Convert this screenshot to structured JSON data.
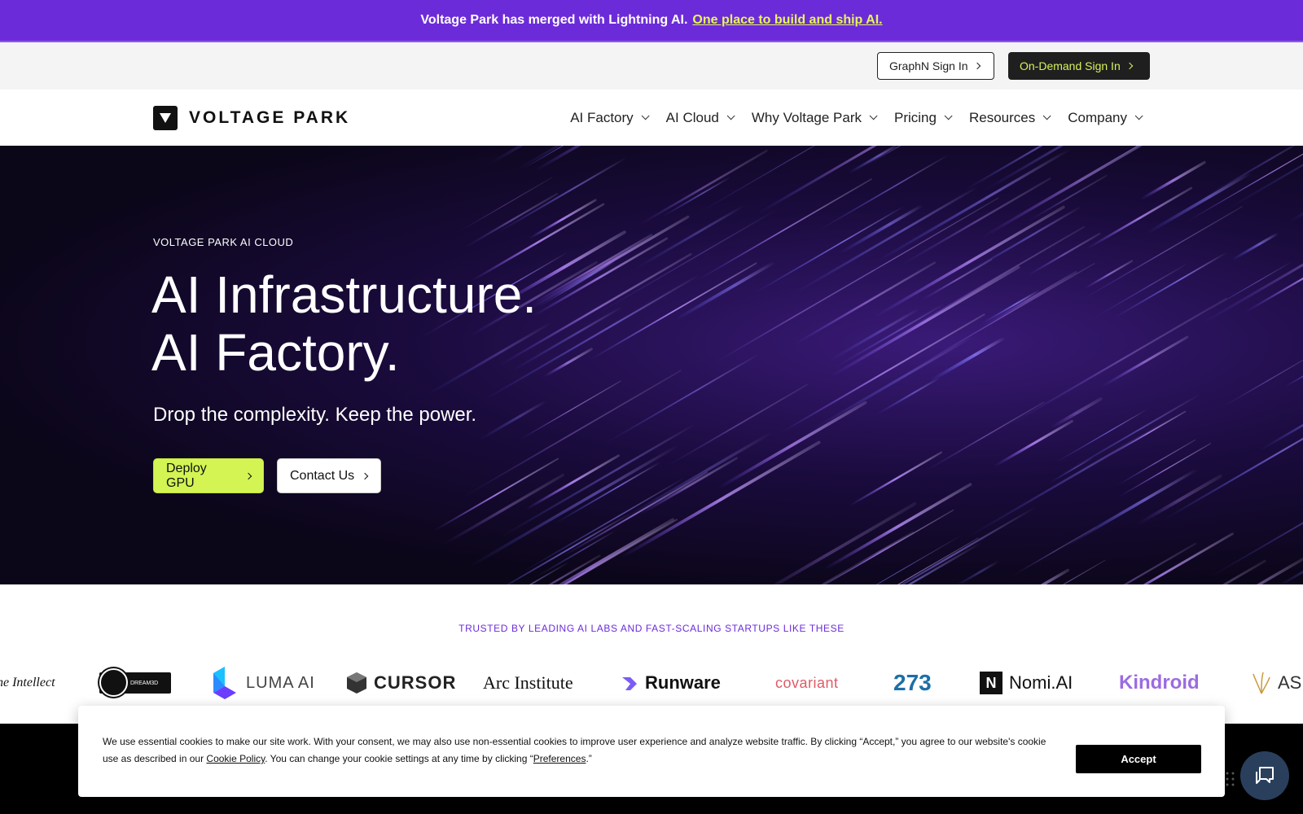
{
  "announcement": {
    "text": "Voltage Park has merged with Lightning AI.",
    "link": "One place to build and ship AI."
  },
  "account_bar": {
    "graphn_label": "GraphN Sign In",
    "ondemand_label": "On-Demand Sign In"
  },
  "nav": {
    "logo_text": "VOLTAGE PARK",
    "items": [
      "AI Factory",
      "AI Cloud",
      "Why Voltage Park",
      "Pricing",
      "Resources",
      "Company"
    ]
  },
  "hero": {
    "eyebrow": "VOLTAGE PARK AI CLOUD",
    "title_line1": "AI Infrastructure.",
    "title_line2": "AI Factory.",
    "subtitle": "Drop the complexity. Keep the power.",
    "primary_button": "Deploy GPU",
    "secondary_button": "Contact Us"
  },
  "trusted": {
    "title": "TRUSTED BY LEADING AI LABS AND FAST-SCALING STARTUPS LIKE THESE",
    "logos": {
      "intellect": "ne Intellect",
      "dream": "DREAM3D",
      "luma": "LUMA AI",
      "cursor": "CURSOR",
      "arc": "Arc Institute",
      "runware": "Runware",
      "covariant": "covariant",
      "n273": "273",
      "nomi": "Nomi.AI",
      "kindroid": "Kindroid",
      "asi": "AS"
    }
  },
  "cookie": {
    "text_part1": "We use essential cookies to make our site work. With your consent, we may also use non-essential cookies to improve user experience and analyze website traffic. By clicking “Accept,” you agree to our website's cookie use as described in our ",
    "policy_link": "Cookie Policy",
    "text_part2": ". You can change your cookie settings at any time by clicking “",
    "preferences_link": "Preferences",
    "text_part3": ".”",
    "accept_label": "Accept"
  },
  "colors": {
    "announcement_bg": "#6c2bd9",
    "accent_lime": "#d3f453",
    "hero_bg": "#0b0618",
    "chat_bg": "#2a3f5c"
  },
  "icons": {
    "chat": "chat-bubble-icon",
    "chevron_right": "chevron-right-icon",
    "chevron_down": "chevron-down-icon"
  }
}
